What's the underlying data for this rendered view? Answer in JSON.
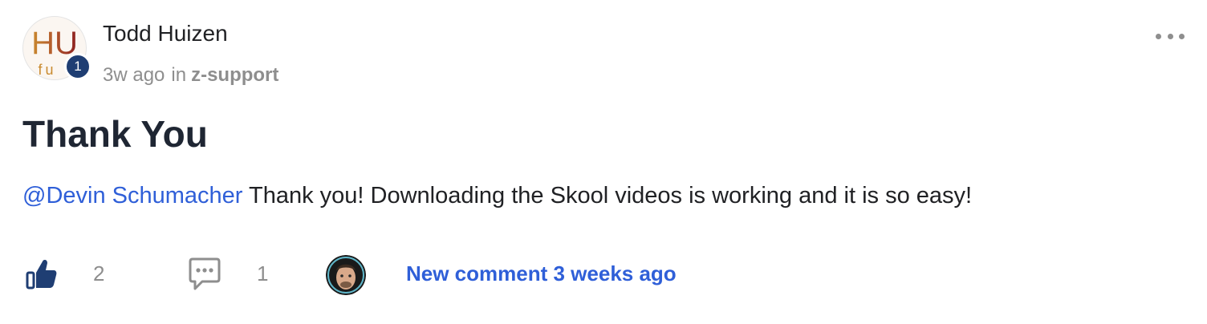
{
  "post": {
    "author": {
      "name": "Todd Huizen",
      "avatar_text_top": "HU",
      "avatar_text_bottom": "fu",
      "level": "1"
    },
    "timestamp": "3w ago",
    "in_label": "in",
    "category": "z-support",
    "title": "Thank You",
    "body": {
      "mention": "@Devin Schumacher",
      "text": " Thank you! Downloading the Skool videos is working and it is so easy!"
    },
    "likes": "2",
    "comments": "1",
    "new_comment": "New comment 3 weeks ago"
  },
  "icons": {
    "more": "more-horizontal-icon",
    "like": "thumbs-up-icon",
    "comment": "comment-icon"
  },
  "colors": {
    "accent": "#2f5fd8",
    "badge": "#1f3e73",
    "like_icon": "#1f3e73",
    "muted": "#8e8e8e"
  }
}
